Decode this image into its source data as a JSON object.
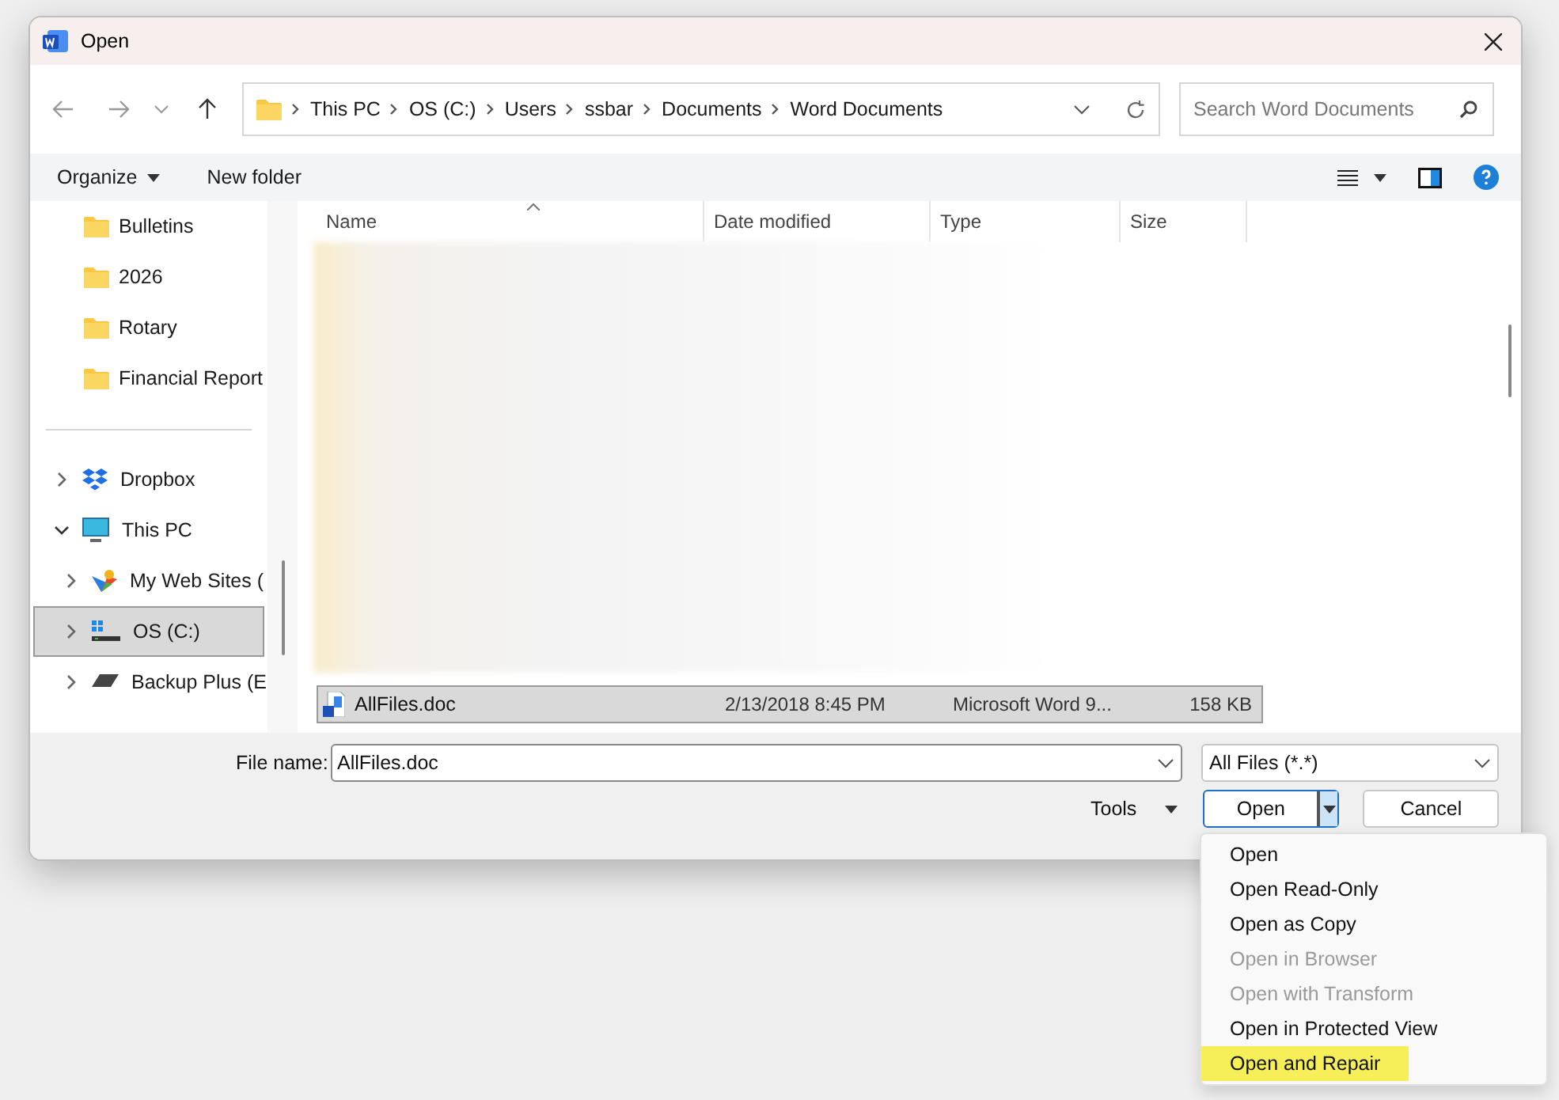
{
  "window": {
    "title": "Open"
  },
  "nav": {
    "breadcrumbs": [
      "This PC",
      "OS (C:)",
      "Users",
      "ssbar",
      "Documents",
      "Word Documents"
    ],
    "search": {
      "placeholder": "Search Word Documents"
    }
  },
  "toolbar": {
    "organize": "Organize",
    "new_folder": "New folder"
  },
  "sidebar": {
    "quick_items": [
      {
        "label": "Bulletins",
        "kind": "folder"
      },
      {
        "label": "2026",
        "kind": "folder"
      },
      {
        "label": "Rotary",
        "kind": "folder"
      },
      {
        "label": "Financial Report",
        "kind": "folder"
      }
    ],
    "tree": [
      {
        "label": "Dropbox",
        "kind": "dropbox",
        "expanded": false,
        "selected": false
      },
      {
        "label": "This PC",
        "kind": "pc",
        "expanded": true,
        "selected": false,
        "children": [
          {
            "label": "My Web Sites (",
            "kind": "websites",
            "expanded": false,
            "selected": false
          },
          {
            "label": "OS (C:)",
            "kind": "drive",
            "expanded": false,
            "selected": true
          },
          {
            "label": "Backup Plus (E",
            "kind": "external",
            "expanded": false,
            "selected": false
          }
        ]
      }
    ]
  },
  "file_list": {
    "columns": [
      "Name",
      "Date modified",
      "Type",
      "Size"
    ],
    "rows": [
      {
        "name": "AllFiles.doc",
        "date_modified": "2/13/2018 8:45 PM",
        "type": "Microsoft Word 9...",
        "size": "158 KB",
        "selected": true
      }
    ]
  },
  "footer": {
    "file_name_label": "File name:",
    "file_name": "AllFiles.doc",
    "file_type": "All Files (*.*)",
    "tools": "Tools",
    "open": "Open",
    "cancel": "Cancel"
  },
  "open_menu": {
    "items": [
      {
        "label": "Open",
        "disabled": false,
        "highlighted": false
      },
      {
        "label": "Open Read-Only",
        "disabled": false,
        "highlighted": false
      },
      {
        "label": "Open as Copy",
        "disabled": false,
        "highlighted": false
      },
      {
        "label": "Open in Browser",
        "disabled": true,
        "highlighted": false
      },
      {
        "label": "Open with Transform",
        "disabled": true,
        "highlighted": false
      },
      {
        "label": "Open in Protected View",
        "disabled": false,
        "highlighted": false
      },
      {
        "label": "Open and Repair",
        "disabled": false,
        "highlighted": true
      }
    ]
  }
}
